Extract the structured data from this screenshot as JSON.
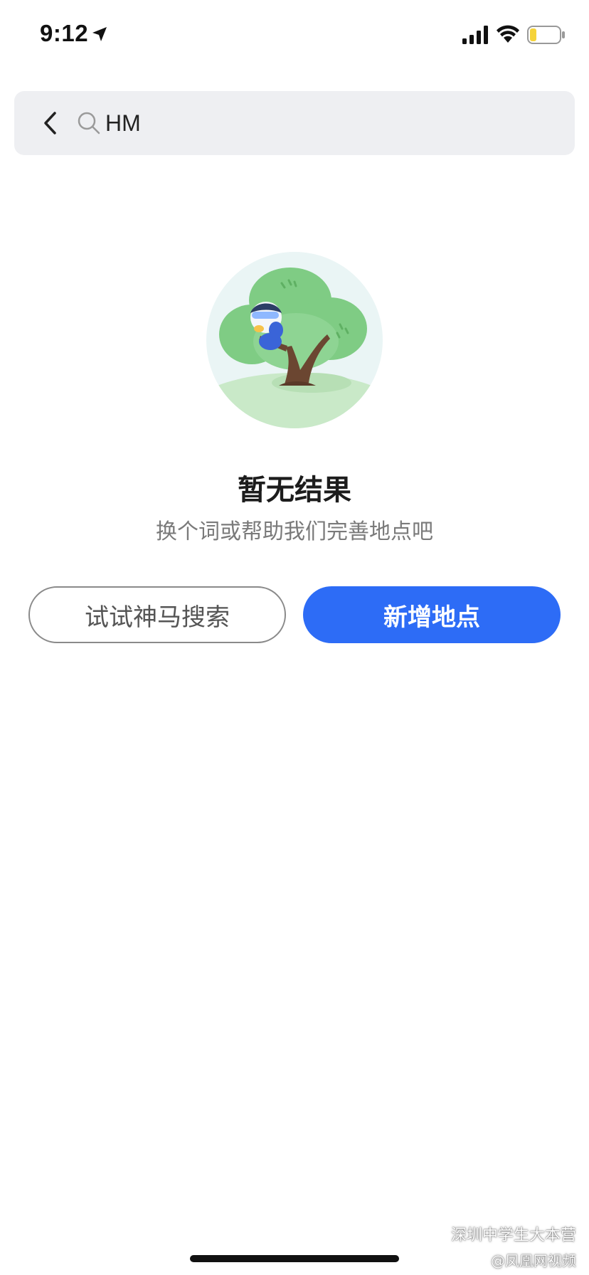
{
  "status_bar": {
    "time": "9:12"
  },
  "search": {
    "query": "HM"
  },
  "empty_state": {
    "title": "暂无结果",
    "subtitle": "换个词或帮助我们完善地点吧"
  },
  "actions": {
    "try_search_label": "试试神马搜索",
    "add_place_label": "新增地点"
  },
  "watermark": {
    "source": "深圳中学生大本营",
    "handle": "@凤凰网视频"
  },
  "colors": {
    "primary": "#2d6cf6",
    "search_bg": "#eeeff2",
    "outline": "#8a8a8a"
  }
}
